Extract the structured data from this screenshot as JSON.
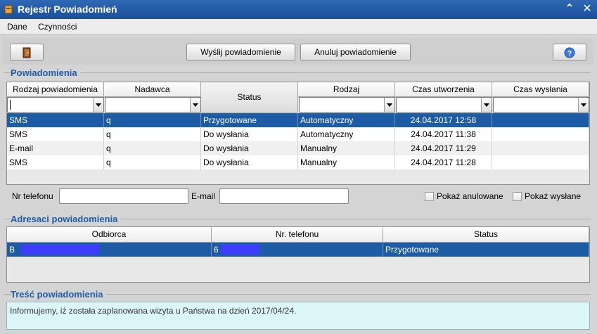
{
  "window": {
    "title": "Rejestr Powiadomień",
    "minimize_glyph": "⌃",
    "close_glyph": "✕"
  },
  "menu": {
    "items": [
      "Dane",
      "Czynności"
    ]
  },
  "toolbar": {
    "exit_icon": "door-exit-icon",
    "send_label": "Wyślij powiadomienie",
    "cancel_label": "Anuluj powiadomienie",
    "help_icon": "help-icon"
  },
  "notifications": {
    "section_title": "Powiadomienia",
    "columns": [
      "Rodzaj powiadomienia",
      "Nadawca",
      "Status",
      "Rodzaj",
      "Czas utworzenia",
      "Czas wysłania"
    ],
    "rows": [
      [
        "SMS",
        "q",
        "Przygotowane",
        "Automatyczny",
        "24.04.2017 12:58",
        ""
      ],
      [
        "SMS",
        "q",
        "Do wysłania",
        "Automatyczny",
        "24.04.2017 11:38",
        ""
      ],
      [
        "E-mail",
        "q",
        "Do wysłania",
        "Manualny",
        "24.04.2017 11:29",
        ""
      ],
      [
        "SMS",
        "q",
        "Do wysłania",
        "Manualny",
        "24.04.2017 11:28",
        ""
      ]
    ],
    "selected_row": 0
  },
  "filters": {
    "phone_label": "Nr telefonu",
    "phone_value": "",
    "email_label": "E-mail",
    "email_value": "",
    "show_cancelled_label": "Pokaż anulowane",
    "show_cancelled": false,
    "show_sent_label": "Pokaż wysłane",
    "show_sent": false
  },
  "recipients": {
    "section_title": "Adresaci powiadomienia",
    "columns": [
      "Odbiorca",
      "Nr. telefonu",
      "Status"
    ],
    "rows": [
      [
        "B",
        "6",
        "Przygotowane"
      ]
    ]
  },
  "content": {
    "section_title": "Treść powiadomienia",
    "text": "Informujemy, iż została zaplanowana wizyta u Państwa na dzień  2017/04/24."
  },
  "colors": {
    "titlebar": "#1b4f9a",
    "selection": "#1d5ca5",
    "section_title": "#1e5da8",
    "content_bg": "#dcf6f8"
  }
}
